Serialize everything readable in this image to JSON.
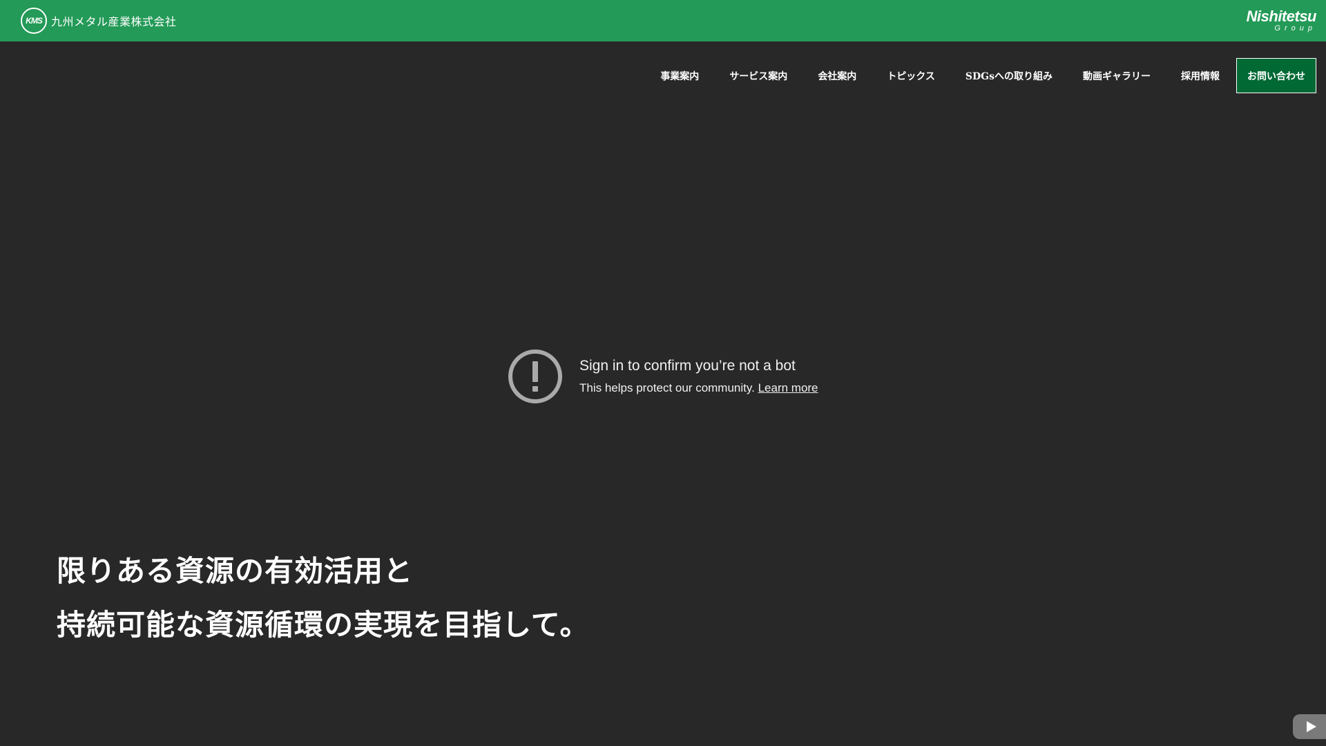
{
  "header": {
    "logo_text": "KMS",
    "company_name": "九州メタル産業株式会社",
    "group_logo_top": "Nishitetsu",
    "group_logo_bottom": "Group",
    "bar_color": "#239a57"
  },
  "nav": {
    "items": [
      {
        "label": "事業案内"
      },
      {
        "label": "サービス案内"
      },
      {
        "label": "会社案内"
      },
      {
        "label": "トピックス"
      },
      {
        "label": "SDGsへの取り組み"
      },
      {
        "label": "動画ギャラリー"
      },
      {
        "label": "採用情報"
      }
    ],
    "contact_label": "お問い合わせ",
    "contact_color": "#006934"
  },
  "video_notice": {
    "icon": "alert-circle-icon",
    "title": "Sign in to confirm you’re not a bot",
    "subtitle": "This helps protect our community.",
    "link_label": "Learn more"
  },
  "hero": {
    "line1": "限りある資源の有効活用と",
    "line2": "持続可能な資源循環の実現を目指して。"
  },
  "player": {
    "youtube_button_icon": "youtube-play-icon"
  }
}
